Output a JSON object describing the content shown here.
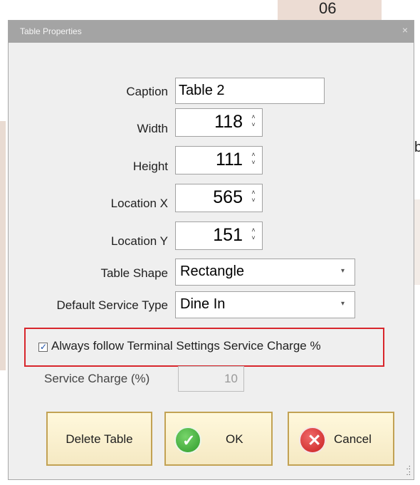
{
  "background": {
    "top_number": "06",
    "right_fragment": "b"
  },
  "dialog": {
    "title": "Table Properties",
    "close_glyph": "×"
  },
  "fields": {
    "caption": {
      "label": "Caption",
      "value": "Table 2"
    },
    "width": {
      "label": "Width",
      "value": "118"
    },
    "height": {
      "label": "Height",
      "value": "111"
    },
    "location_x": {
      "label": "Location X",
      "value": "565"
    },
    "location_y": {
      "label": "Location Y",
      "value": "151"
    },
    "table_shape": {
      "label": "Table Shape",
      "value": "Rectangle"
    },
    "default_service_type": {
      "label": "Default Service Type",
      "value": "Dine In"
    }
  },
  "service_charge": {
    "checkbox_label": "Always follow Terminal Settings Service Charge %",
    "checked": true,
    "label": "Service Charge (%)",
    "value": "10"
  },
  "buttons": {
    "delete": "Delete Table",
    "ok": "OK",
    "cancel": "Cancel"
  },
  "icons": {
    "spin": "spin-up-down-icon",
    "dropdown": "chevron-down-icon",
    "ok": "checkmark-icon",
    "cancel": "close-circle-icon"
  },
  "colors": {
    "highlight": "#d8262c",
    "button_border": "#c2a254",
    "ok_green": "#2e9b2b",
    "cancel_red": "#c81e1e"
  }
}
